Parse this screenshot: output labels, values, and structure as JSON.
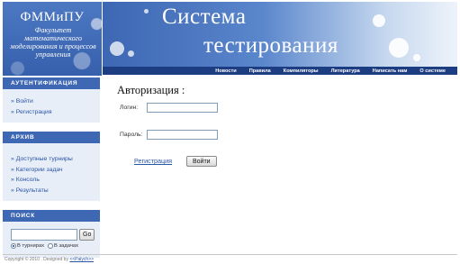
{
  "header": {
    "logo_title": "ФММиПУ",
    "logo_subtitle": "Факультет математического моделирования и процессов управления",
    "banner_line1": "Система",
    "banner_line2": "тестирования",
    "nav": [
      "Новости",
      "Правила",
      "Компиляторы",
      "Литература",
      "Написать нам",
      "О системе"
    ]
  },
  "sidebar": {
    "auth": {
      "heading": "АУТЕНТИФИКАЦИЯ",
      "links": [
        "Войти",
        "Регистрация"
      ]
    },
    "archive": {
      "heading": "АРХИВ",
      "links": [
        "Доступные турниры",
        "Категории задач",
        "Консоль",
        "Результаты"
      ]
    },
    "search": {
      "heading": "ПОИСК",
      "value": "",
      "button": "Go",
      "options": [
        "В турнирах",
        "В задачах"
      ],
      "selected": "В турнирах"
    }
  },
  "main": {
    "title": "Авторизация :",
    "login_label": "Логин:",
    "login_value": "",
    "password_label": "Пароль:",
    "password_value": "",
    "register_link": "Регистрация",
    "submit_button": "Войти"
  },
  "footer": {
    "copyright": "Copyright © 2010 . Designed by",
    "designer": "<<Palych>>"
  }
}
